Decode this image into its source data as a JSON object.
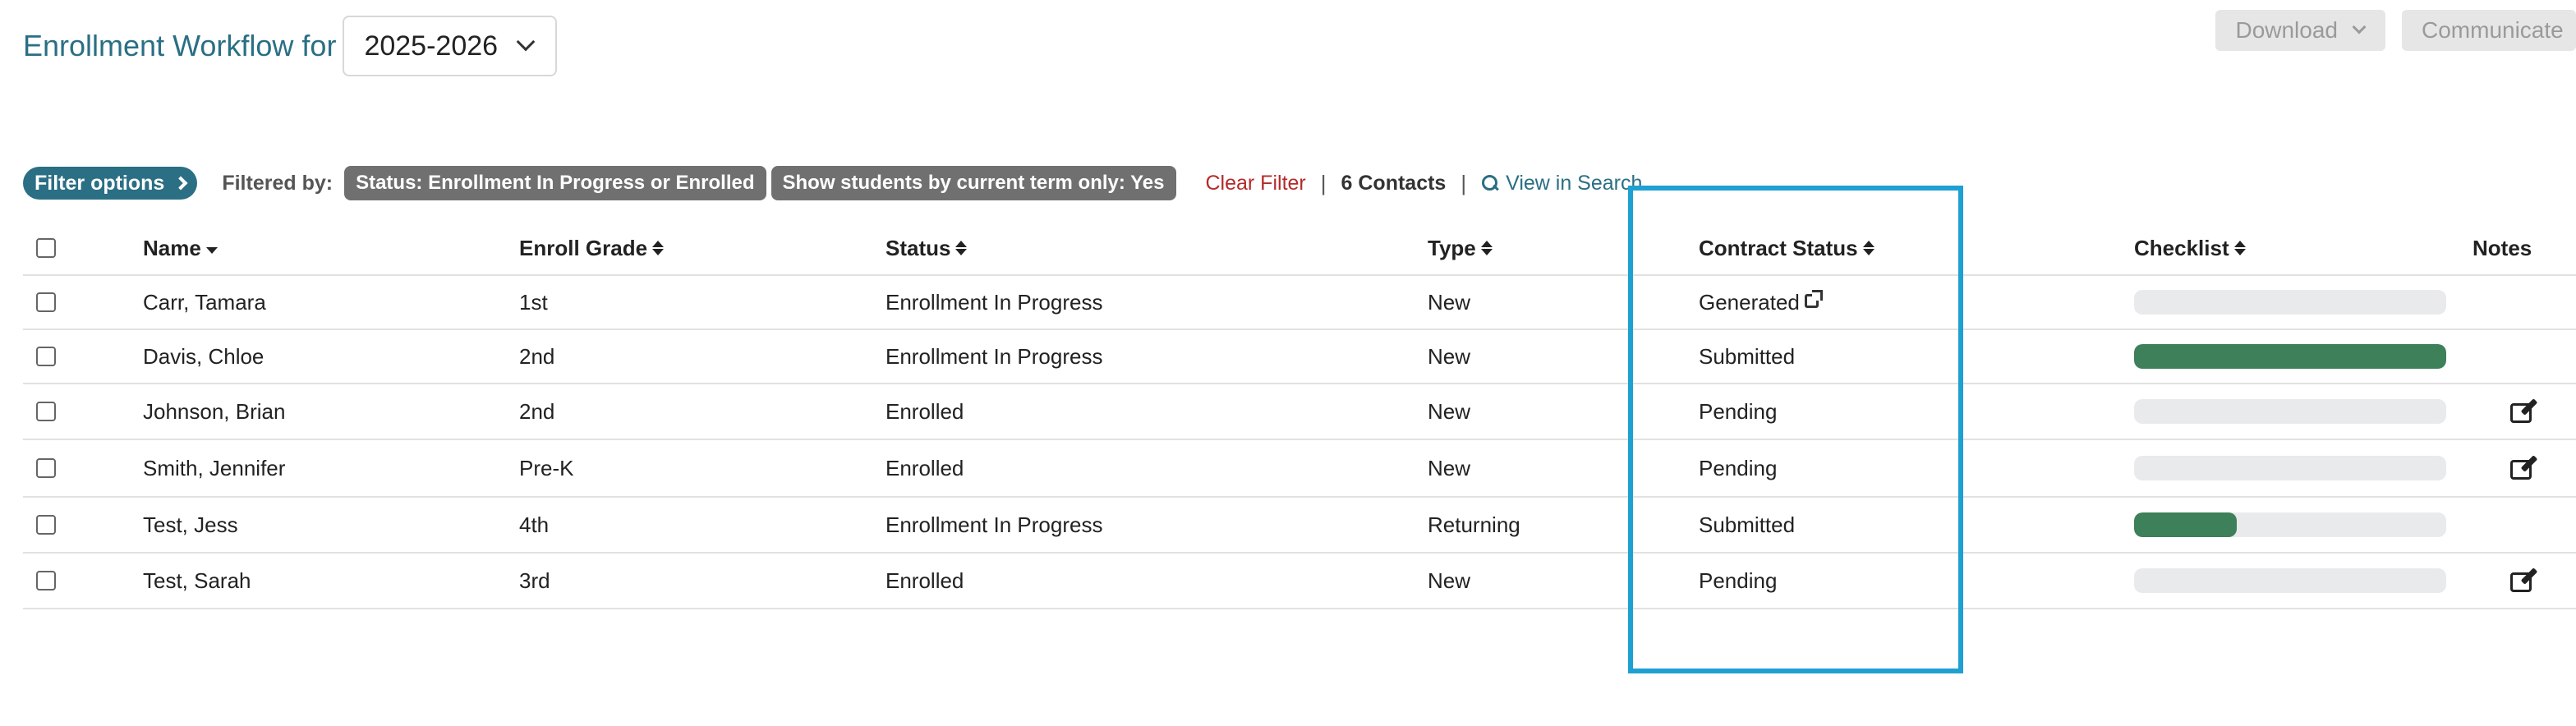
{
  "header": {
    "title": "Enrollment Workflow for",
    "year_select": "2025-2026"
  },
  "actions": {
    "download": "Download",
    "communicate": "Communicate"
  },
  "filters": {
    "options_label": "Filter options",
    "filtered_by_label": "Filtered by:",
    "chips": [
      "Status: Enrollment In Progress or Enrolled",
      "Show students by current term only: Yes"
    ],
    "clear_label": "Clear Filter",
    "contacts_count": "6 Contacts",
    "view_search": "View in Search"
  },
  "table": {
    "columns": {
      "name": "Name",
      "grade": "Enroll Grade",
      "status": "Status",
      "type": "Type",
      "contract": "Contract Status",
      "checklist": "Checklist",
      "notes": "Notes"
    },
    "rows": [
      {
        "name": "Carr, Tamara",
        "grade": "1st",
        "status": "Enrollment In Progress",
        "type": "New",
        "contract": "Generated",
        "contract_link": true,
        "checklist": 0,
        "has_note": false
      },
      {
        "name": "Davis, Chloe",
        "grade": "2nd",
        "status": "Enrollment In Progress",
        "type": "New",
        "contract": "Submitted",
        "contract_link": false,
        "checklist": 100,
        "has_note": false
      },
      {
        "name": "Johnson, Brian",
        "grade": "2nd",
        "status": "Enrolled",
        "type": "New",
        "contract": "Pending",
        "contract_link": false,
        "checklist": 0,
        "has_note": true
      },
      {
        "name": "Smith, Jennifer",
        "grade": "Pre-K",
        "status": "Enrolled",
        "type": "New",
        "contract": "Pending",
        "contract_link": false,
        "checklist": 0,
        "has_note": true
      },
      {
        "name": "Test, Jess",
        "grade": "4th",
        "status": "Enrollment In Progress",
        "type": "Returning",
        "contract": "Submitted",
        "contract_link": false,
        "checklist": 33,
        "has_note": false
      },
      {
        "name": "Test, Sarah",
        "grade": "3rd",
        "status": "Enrolled",
        "type": "New",
        "contract": "Pending",
        "contract_link": false,
        "checklist": 0,
        "has_note": true
      }
    ]
  },
  "colors": {
    "accent": "#2a6f84",
    "progress_fill": "#3d8059",
    "highlight": "#1ea0d2",
    "clear_filter": "#b42a2a"
  }
}
